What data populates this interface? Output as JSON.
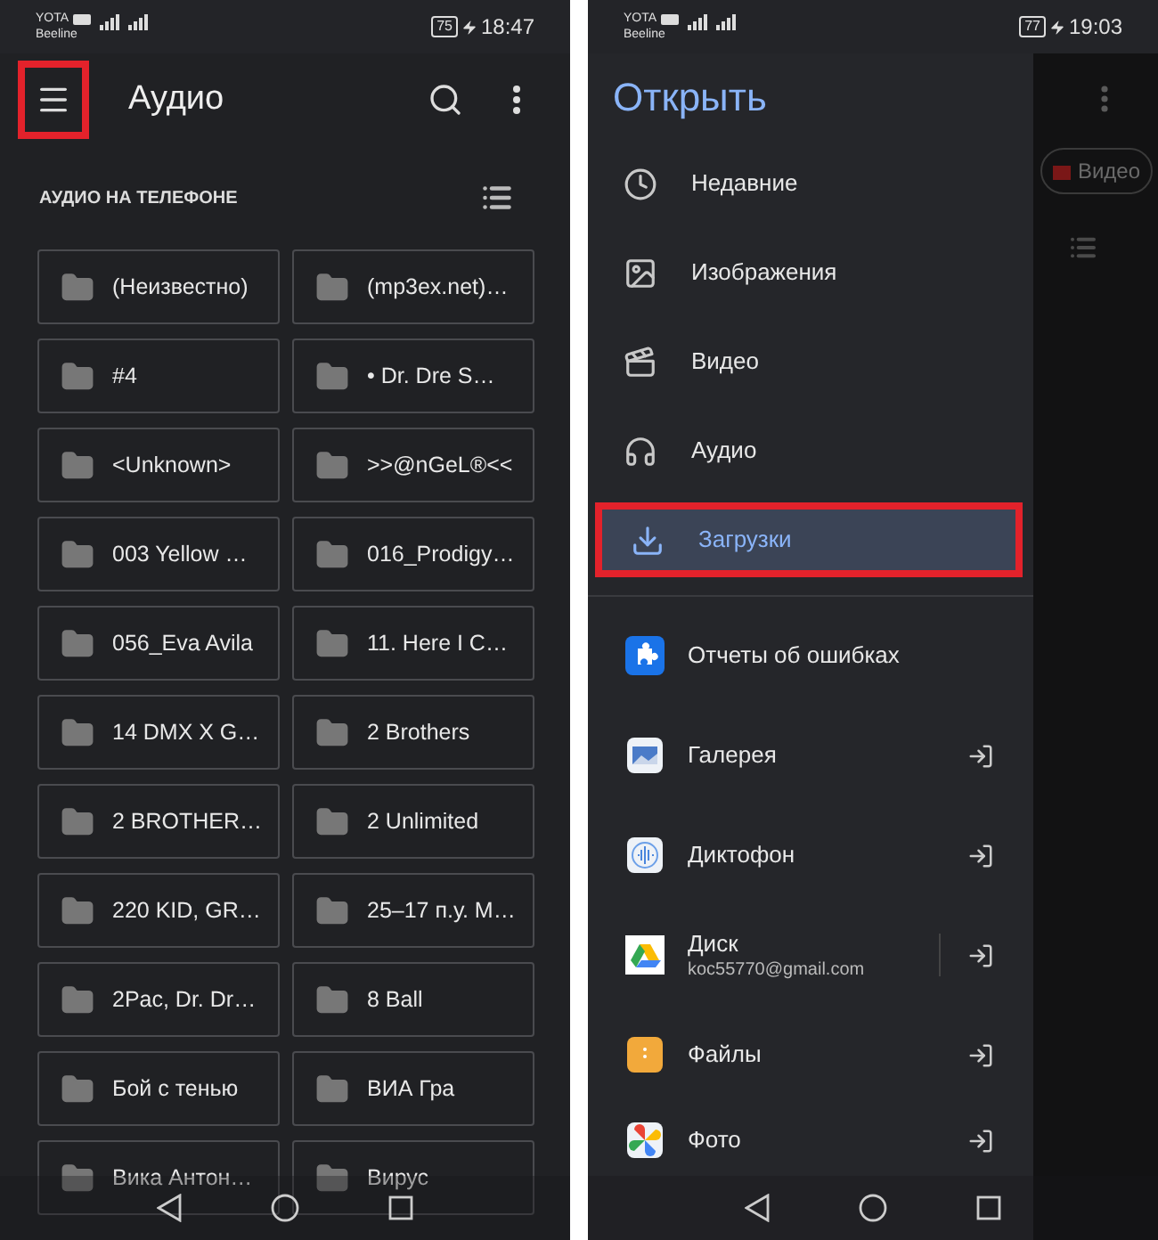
{
  "left_phone": {
    "status_bar": {
      "carrier": "YOTA",
      "carrier_2": "Beeline",
      "battery": "75",
      "time": "18:47"
    },
    "app_bar": {
      "title": "Аудио",
      "menu_annotated": true
    },
    "section": {
      "title": "АУДИО НА ТЕЛЕФОНЕ"
    },
    "folders": [
      "(Неизвестно)",
      "(mp3ex.net)…",
      "#4",
      "• Dr. Dre  S…",
      "<Unknown>",
      ">>@nGeL®<<",
      "003 Yellow …",
      "016_Prodigy…",
      "056_Eva Avila",
      "11. Here I C…",
      "14 DMX X G…",
      "2 Brothers",
      "2 BROTHER…",
      "2 Unlimited",
      "220 KID, GR…",
      "25–17 п.у. M…",
      "2Pac, Dr. Dr…",
      "8 Ball",
      "Бой с тенью",
      "ВИА Гра",
      "Вика Антон…",
      "Вирус"
    ]
  },
  "right_phone": {
    "status_bar": {
      "carrier": "YOTA",
      "carrier_2": "Beeline",
      "battery": "77",
      "time": "19:03"
    },
    "drawer": {
      "title": "Открыть",
      "items": [
        {
          "label": "Недавние",
          "kind": "clock",
          "selected": false,
          "annotated": false
        },
        {
          "label": "Изображения",
          "kind": "image",
          "selected": false,
          "annotated": false
        },
        {
          "label": "Видео",
          "kind": "video",
          "selected": false,
          "annotated": false
        },
        {
          "label": "Аудио",
          "kind": "audio",
          "selected": false,
          "annotated": false
        },
        {
          "label": "Загрузки",
          "kind": "download",
          "selected": true,
          "annotated": true
        }
      ],
      "apps": [
        {
          "label": "Отчеты об ошибках",
          "kind": "bugreport",
          "external": false
        },
        {
          "label": "Галерея",
          "kind": "gallery",
          "external": true
        },
        {
          "label": "Диктофон",
          "kind": "recorder",
          "external": true
        },
        {
          "label": "Диск",
          "subtitle": "koc55770@gmail.com",
          "kind": "drive",
          "external": true
        },
        {
          "label": "Файлы",
          "kind": "files",
          "external": true
        },
        {
          "label": "Фото",
          "kind": "photos",
          "external": true
        }
      ]
    },
    "background": {
      "chip": "Видео"
    }
  }
}
